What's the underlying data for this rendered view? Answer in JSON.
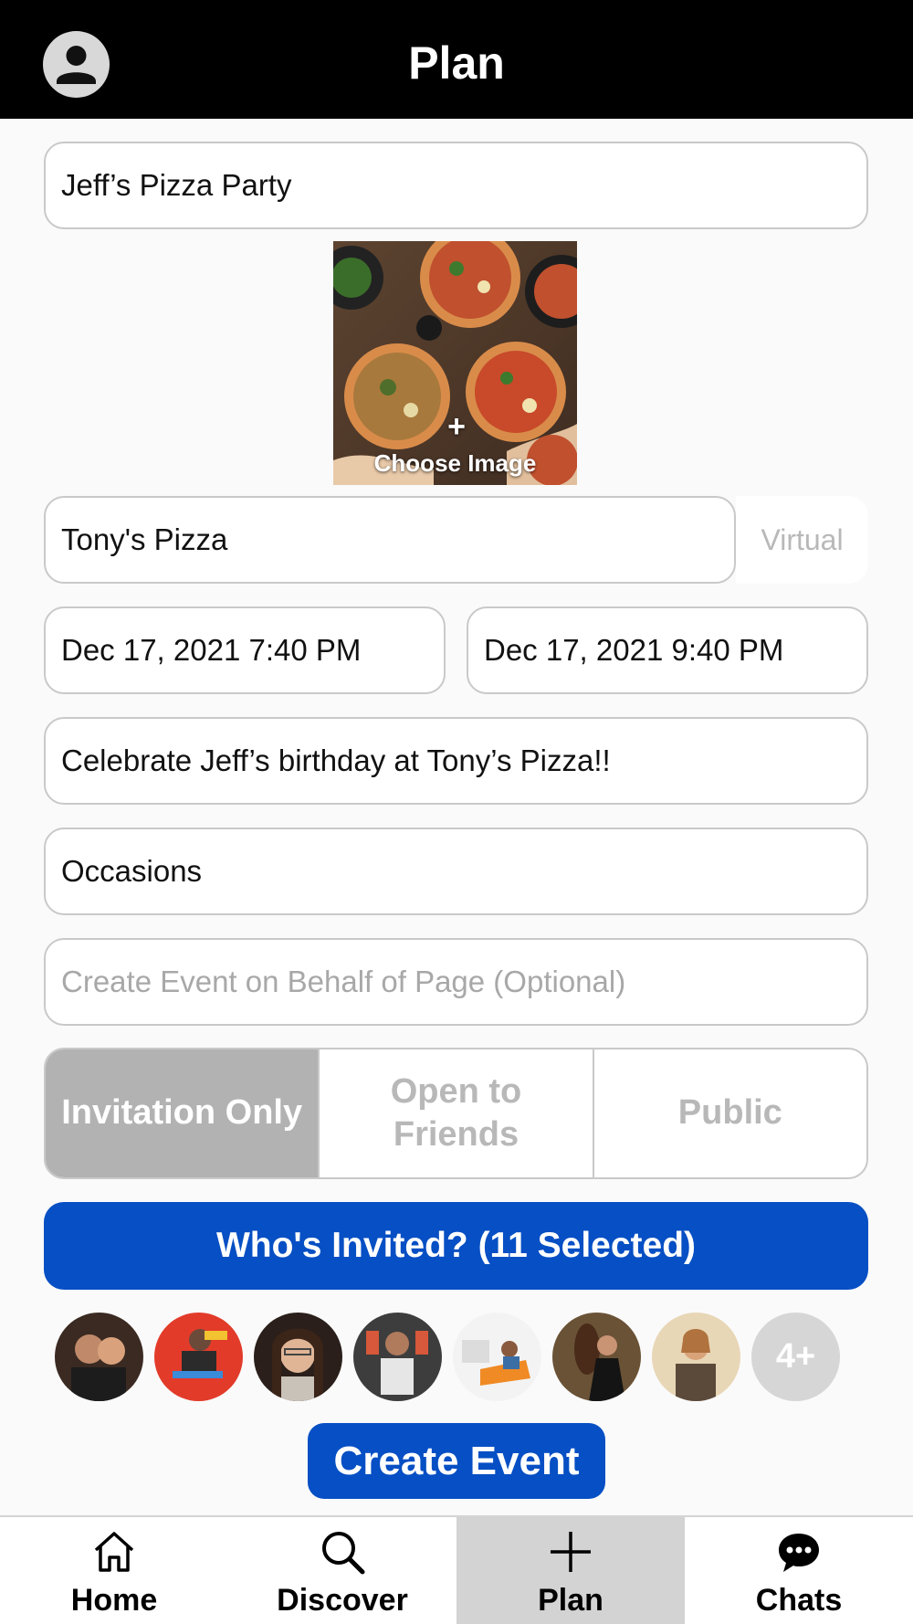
{
  "header": {
    "title": "Plan",
    "profile_icon": "user-icon"
  },
  "form": {
    "event_name": "Jeff’s Pizza Party",
    "image": {
      "plus": "+",
      "label": "Choose Image"
    },
    "location": "Tony's Pizza",
    "virtual_label": "Virtual",
    "start_datetime": "Dec 17, 2021 7:40 PM",
    "end_datetime": "Dec 17, 2021 9:40 PM",
    "description": "Celebrate Jeff’s birthday at Tony’s Pizza!!",
    "category": "Occasions",
    "page_placeholder": "Create Event on Behalf of Page (Optional)"
  },
  "visibility": {
    "options": [
      "Invitation Only",
      "Open to Friends",
      "Public"
    ],
    "selected": "Invitation Only"
  },
  "invite_button": "Who's Invited? (11 Selected)",
  "invitees": {
    "shown": 7,
    "more_label": "4+"
  },
  "create_button": "Create Event",
  "tabs": [
    {
      "label": "Home",
      "icon": "home-icon"
    },
    {
      "label": "Discover",
      "icon": "search-icon"
    },
    {
      "label": "Plan",
      "icon": "plus-icon",
      "active": true
    },
    {
      "label": "Chats",
      "icon": "chat-icon"
    }
  ],
  "colors": {
    "accent": "#064fc4",
    "header": "#000000",
    "segment_active": "#b2b2b2"
  }
}
